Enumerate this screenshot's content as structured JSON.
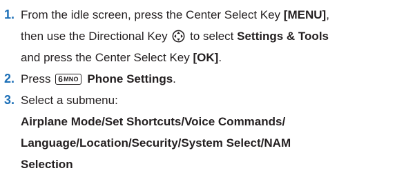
{
  "steps": [
    {
      "number": "1.",
      "line1_pre": "From the idle screen, press the Center Select Key ",
      "line1_key": "[MENU]",
      "line1_post": ",",
      "line2_pre": "then use the Directional Key",
      "line2_post": "to select ",
      "line2_bold": "Settings & Tools",
      "line3_pre": "and press the Center Select Key ",
      "line3_key": "[OK]",
      "line3_post": ".",
      "icon": "directional-key-icon"
    },
    {
      "number": "2.",
      "pre": "Press",
      "key_digit": "6",
      "key_letters": "MNO",
      "bold": "Phone Settings",
      "post": ".",
      "icon": "key-6-mno-icon"
    },
    {
      "number": "3.",
      "text": "Select a submenu:",
      "submenu_lines": [
        "Airplane Mode/Set Shortcuts/Voice Commands/",
        "Language/Location/Security/System Select/NAM",
        "Selection"
      ]
    }
  ],
  "colors": {
    "step_number": "#1c6fb7",
    "text": "#231f20"
  }
}
